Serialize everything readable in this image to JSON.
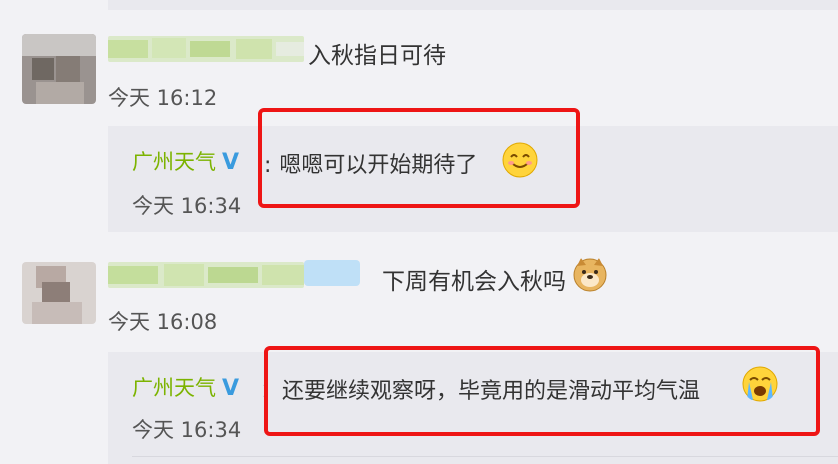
{
  "thread": [
    {
      "comment": {
        "text": "入秋指日可待",
        "time": "今天 16:12"
      },
      "reply": {
        "author": "广州天气",
        "verified_badge": "V",
        "separator": ":",
        "text": "嗯嗯可以开始期待了",
        "time": "今天 16:34",
        "emoji": "smile-emoji"
      }
    },
    {
      "comment": {
        "text": "下周有机会入秋吗",
        "time": "今天 16:08",
        "emoji": "doge-emoji"
      },
      "reply": {
        "author": "广州天气",
        "verified_badge": "V",
        "separator": "：",
        "text": "还要继续观察呀，毕竟用的是滑动平均气温",
        "time": "今天 16:34",
        "emoji": "crying-emoji"
      }
    }
  ],
  "colors": {
    "author": "#7cb300",
    "highlight_box": "#ee1515",
    "badge": "#3a9bde"
  }
}
